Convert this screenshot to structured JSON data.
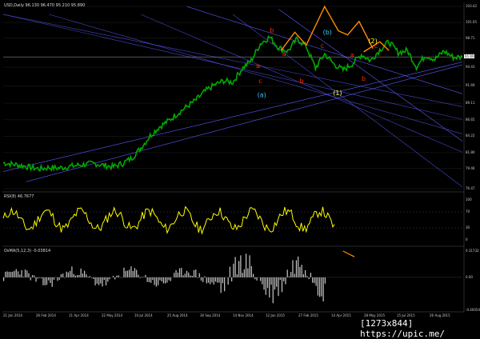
{
  "watermark": "[1273x844] https://upic.me/",
  "colors": {
    "background": "#000000",
    "price": "#00aa00",
    "trendlines": "#5a5aff",
    "rsi": "#ffff00",
    "osma": "#c8c8c8",
    "wave_red": "#ff2a00",
    "wave_orange": "#ff8c00",
    "wave_cyan": "#3ec7ff",
    "wave_yellow": "#ffff33",
    "grid": "#2a2a2a"
  },
  "chart_data": [
    {
      "type": "line",
      "panel": "price",
      "title": "USD,Daily 96.130 96.470 95.210 95.890",
      "ylim": [
        76.47,
        103.42
      ],
      "y_ticks": [
        "103.42",
        "101.05",
        "98.71",
        "96.05",
        "94.43",
        "91.69",
        "89.11",
        "86.65",
        "84.22",
        "81.80",
        "79.46",
        "76.47"
      ],
      "last_price": "95.89",
      "x_ticks": [
        "21 Jan 2014",
        "26 Feb 2014",
        "11 Apr 2014",
        "22 May 2014",
        "10 Jul 2014",
        "25 Aug 2014",
        "30 Sep 2014",
        "14 Nov 2014",
        "12 Jan 2015",
        "27 Feb 2015",
        "14 Apr 2015",
        "28 May 2015",
        "15 Jul 2015",
        "26 Aug 2015"
      ],
      "x_range": [
        0,
        100
      ],
      "series": [
        {
          "x": [
            0,
            2,
            4,
            6,
            8,
            10,
            12,
            14,
            16,
            18,
            20,
            22,
            24,
            26,
            28,
            30,
            32,
            34,
            36,
            38,
            40,
            42,
            44,
            46,
            48,
            50,
            52,
            54,
            56,
            58,
            60,
            62,
            64,
            66,
            68,
            70,
            72,
            74,
            76,
            78,
            80,
            82,
            84,
            86,
            88,
            90,
            92,
            94,
            96,
            98,
            100
          ],
          "values": [
            80.3,
            80.1,
            79.9,
            79.6,
            79.4,
            79.6,
            79.5,
            79.7,
            79.9,
            80.1,
            80.2,
            79.9,
            79.7,
            80.2,
            81.0,
            82.5,
            84.3,
            85.6,
            86.5,
            87.6,
            88.6,
            89.6,
            90.9,
            91.8,
            92.4,
            92.2,
            94.2,
            95.4,
            97.9,
            98.9,
            97.3,
            96.8,
            98.6,
            97.5,
            94.3,
            96.4,
            94.9,
            94.0,
            94.9,
            96.3,
            95.4,
            97.0,
            98.2,
            96.6,
            96.9,
            94.5,
            96.2,
            95.6,
            96.8,
            95.9,
            95.9
          ]
        }
      ]
    },
    {
      "type": "line",
      "panel": "rsi",
      "title": "RSI(8) 46.7677",
      "ylim": [
        0,
        100
      ],
      "y_ticks": [
        "100",
        "70",
        "30",
        "0"
      ]
    },
    {
      "type": "bar",
      "panel": "osma",
      "title": "OsMA(5,12,3) -0.03814",
      "ylim": [
        -0.4,
        0.32
      ],
      "y_ticks": [
        "0.31732",
        "0.00",
        "-0.40054"
      ]
    }
  ],
  "annotations": {
    "labels": [
      {
        "text": "b",
        "color": "wave_red",
        "x": 58.5,
        "y": 99.6
      },
      {
        "text": "a",
        "color": "wave_red",
        "x": 55.5,
        "y": 94.3
      },
      {
        "text": "c",
        "color": "wave_red",
        "x": 56.0,
        "y": 92.1
      },
      {
        "text": "a",
        "color": "wave_red",
        "x": 61.2,
        "y": 96.1
      },
      {
        "text": "b",
        "color": "wave_red",
        "x": 65.0,
        "y": 92.1
      },
      {
        "text": "c",
        "color": "wave_red",
        "x": 69.5,
        "y": 97.3
      },
      {
        "text": "a",
        "color": "wave_red",
        "x": 76.0,
        "y": 95.9
      },
      {
        "text": "b",
        "color": "wave_red",
        "x": 78.5,
        "y": 92.4
      },
      {
        "text": "c",
        "color": "wave_red",
        "x": 81.2,
        "y": 97.3
      },
      {
        "text": "(a)",
        "color": "wave_cyan",
        "x": 56.3,
        "y": 90.0
      },
      {
        "text": "(b)",
        "color": "wave_cyan",
        "x": 70.6,
        "y": 99.3
      },
      {
        "text": "(1)",
        "color": "wave_yellow",
        "x": 72.8,
        "y": 90.3
      },
      {
        "text": "(2)",
        "color": "wave_yellow",
        "x": 80.5,
        "y": 98.0
      }
    ]
  }
}
